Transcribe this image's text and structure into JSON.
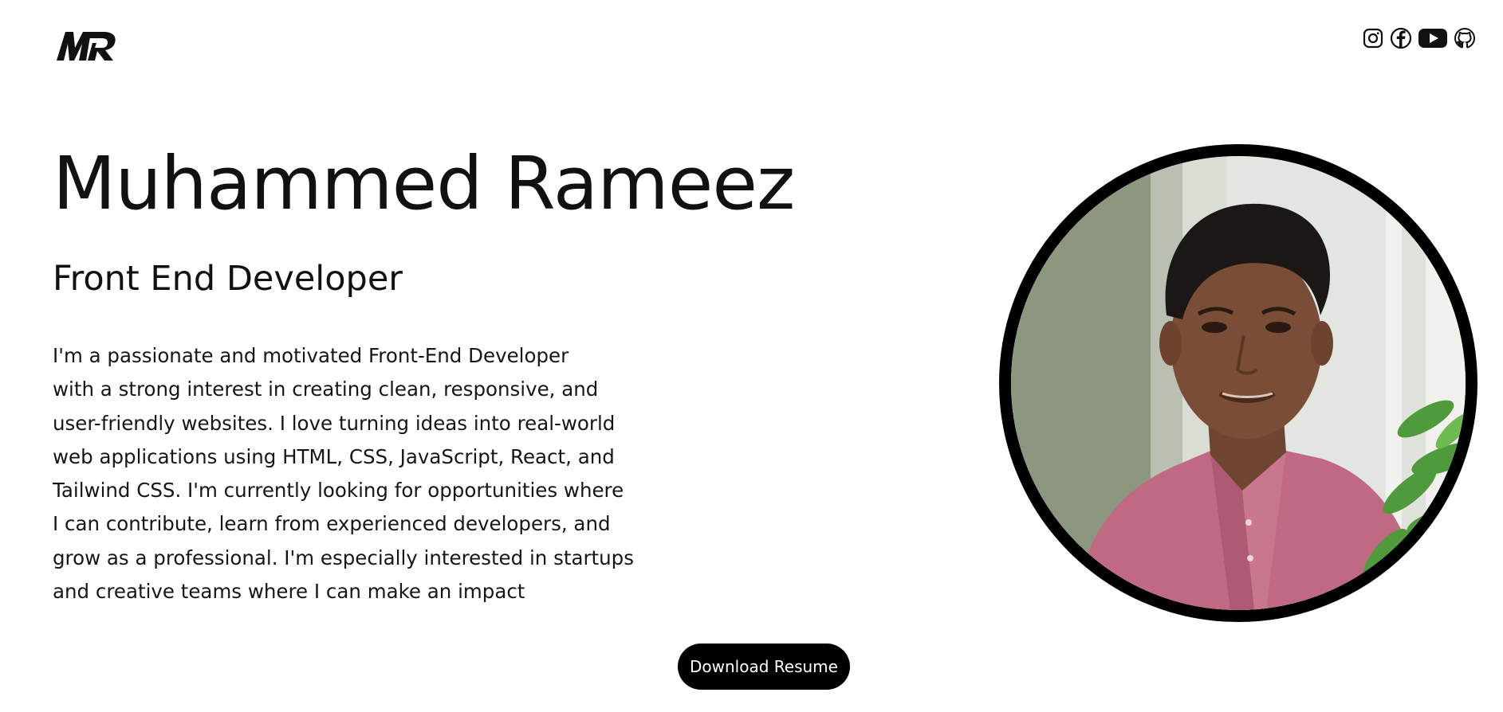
{
  "header": {
    "logo_text": "MR",
    "social_links": [
      {
        "icon": "instagram-icon"
      },
      {
        "icon": "facebook-icon"
      },
      {
        "icon": "youtube-icon"
      },
      {
        "icon": "github-icon"
      }
    ]
  },
  "hero": {
    "name": "Muhammed Rameez",
    "role": "Front End Developer",
    "bio_lines": [
      "I'm a passionate and motivated Front-End Developer",
      "with a strong interest in creating clean, responsive, and",
      "user-friendly websites. I love turning ideas into real-world",
      "web applications using HTML, CSS, JavaScript, React, and",
      "Tailwind CSS. I'm currently looking for opportunities where",
      "I can contribute, learn from experienced developers, and",
      "grow as a professional. I'm especially interested in startups",
      "and creative teams where I can make an impact"
    ],
    "download_button_label": "Download Resume"
  },
  "colors": {
    "background": "#ffffff",
    "text": "#111111",
    "button_background": "#000000",
    "button_text": "#ffffff",
    "photo_border": "#000000"
  }
}
